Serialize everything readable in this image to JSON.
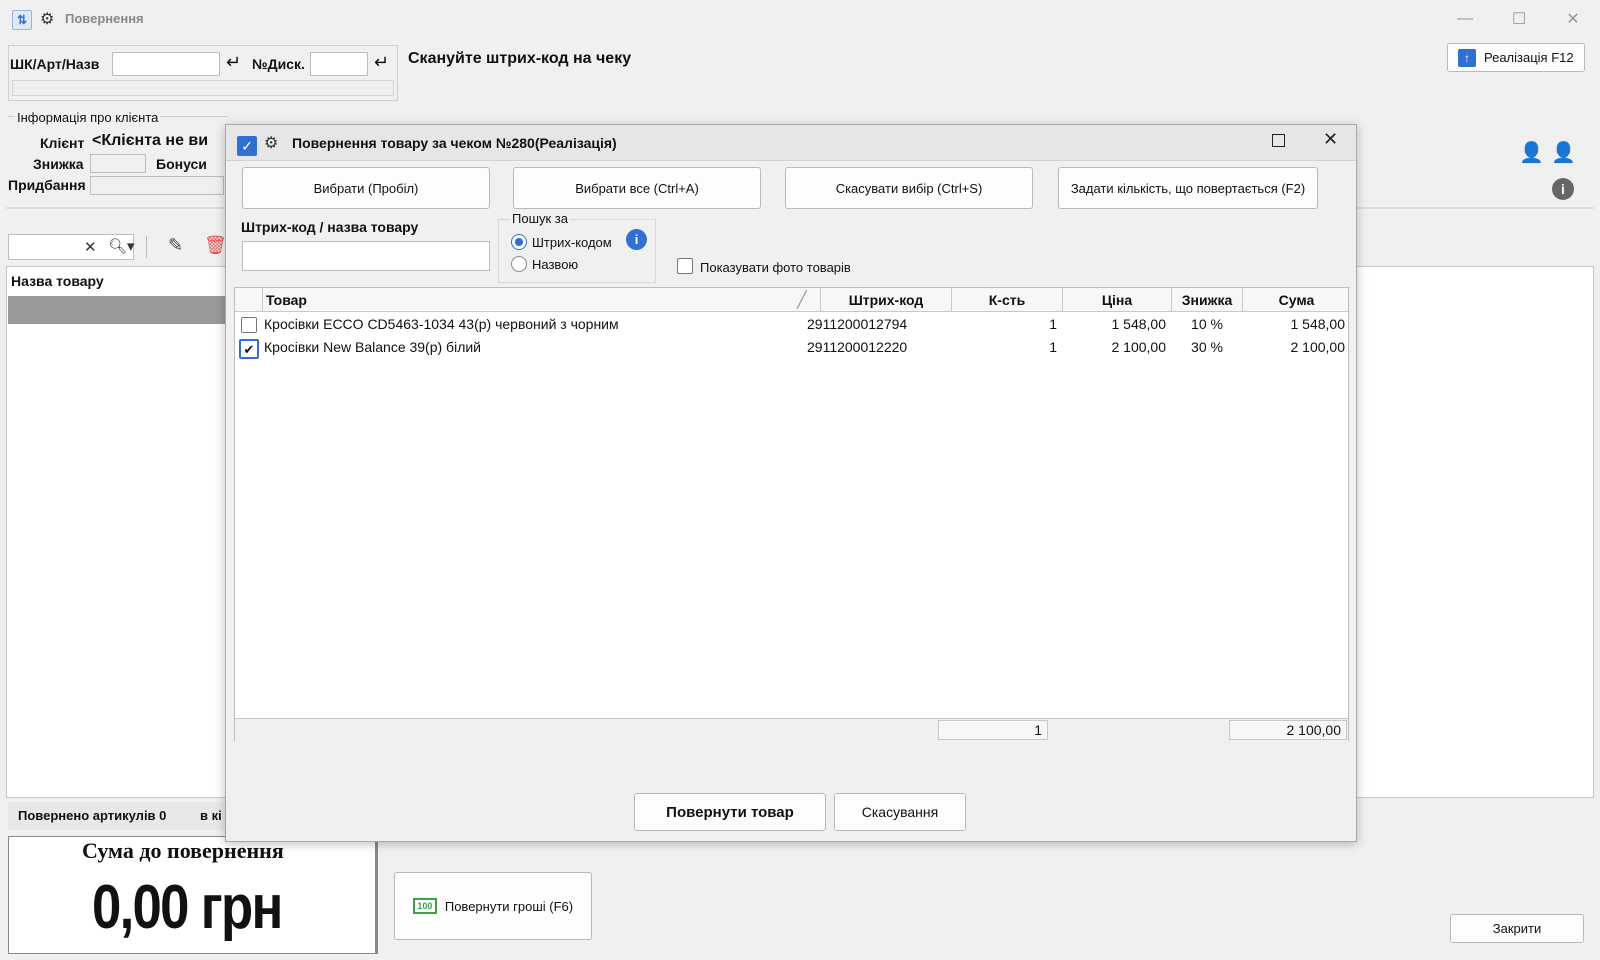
{
  "window": {
    "title": "Повернення",
    "realization_button": "Реалізація F12"
  },
  "scan": {
    "barcode_label": "ШК/Арт/Назв",
    "barcode_value": "",
    "disc_label": "№Диск.",
    "disc_value": "",
    "instruction": "Скануйте штрих-код на чеку"
  },
  "client_info": {
    "group_title": "Інформація про клієнта",
    "client_label": "Клієнт",
    "client_value": "<Клієнта не ви",
    "discount_label": "Знижка",
    "bonus_label": "Бонуси",
    "purchases_label": "Придбання"
  },
  "left_list": {
    "column_header": "Назва товару",
    "status_text": "Повернено артикулів 0",
    "status_text2": "в кі"
  },
  "summary": {
    "title": "Сума до повернення",
    "amount": "0,00 грн",
    "return_money_button": "Повернути гроші (F6)",
    "close_button": "Закрити"
  },
  "dialog": {
    "title": "Повернення товару за чеком №280(Реалізація)",
    "buttons": {
      "select": "Вибрати (Пробіл)",
      "select_all": "Вибрати все (Ctrl+A)",
      "cancel_selection": "Скасувати вибір (Ctrl+S)",
      "set_quantity": "Задати кількість, що повертається (F2)"
    },
    "search": {
      "label": "Штрих-код / назва товару",
      "value": "",
      "group_title": "Пошук за",
      "option_barcode": "Штрих-кодом",
      "option_name": "Назвою",
      "selected": "Штрих-кодом"
    },
    "show_photos_label": "Показувати фото товарів",
    "table": {
      "columns": [
        "Товар",
        "Штрих-код",
        "К-сть",
        "Ціна",
        "Знижка",
        "Сума"
      ],
      "rows": [
        {
          "checked": false,
          "product": "Кросівки ECCO CD5463-1034 43(р) червоний з чорним",
          "barcode": "2911200012794",
          "qty": "1",
          "price": "1 548,00",
          "discount": "10 %",
          "sum": "1 548,00"
        },
        {
          "checked": true,
          "product": "Кросівки New Balance 39(р) білий",
          "barcode": "2911200012220",
          "qty": "1",
          "price": "2 100,00",
          "discount": "30 %",
          "sum": "2 100,00"
        }
      ],
      "footer_qty": "1",
      "footer_sum": "2 100,00"
    },
    "return_button": "Повернути товар",
    "cancel_button": "Скасування"
  },
  "colors": {
    "accent": "#2f6fd6",
    "selection_gray": "#9a9a9a",
    "delete_red": "#e05050",
    "money_green": "#3aa34a"
  }
}
